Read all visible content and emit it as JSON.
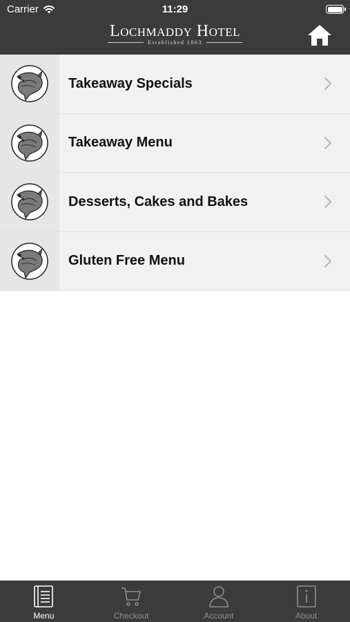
{
  "status_bar": {
    "carrier": "Carrier",
    "time": "11:29"
  },
  "header": {
    "logo_title": "Lochmaddy Hotel",
    "logo_subtitle": "Established 1863",
    "home_icon": "home-icon"
  },
  "menu": {
    "items": [
      {
        "label": "Takeaway Specials",
        "icon": "fish-icon"
      },
      {
        "label": "Takeaway Menu",
        "icon": "fish-icon"
      },
      {
        "label": "Desserts, Cakes and Bakes",
        "icon": "fish-icon"
      },
      {
        "label": "Gluten Free Menu",
        "icon": "fish-icon"
      }
    ]
  },
  "tab_bar": {
    "tabs": [
      {
        "label": "Menu",
        "icon": "menu-book-icon",
        "active": true
      },
      {
        "label": "Checkout",
        "icon": "cart-icon",
        "active": false
      },
      {
        "label": "Account",
        "icon": "user-icon",
        "active": false
      },
      {
        "label": "About",
        "icon": "info-icon",
        "active": false
      }
    ]
  },
  "colors": {
    "bar_background": "#3b3b3b",
    "row_background": "#f1f1f1",
    "tab_active": "#ffffff",
    "tab_inactive": "#8e8e8e"
  }
}
